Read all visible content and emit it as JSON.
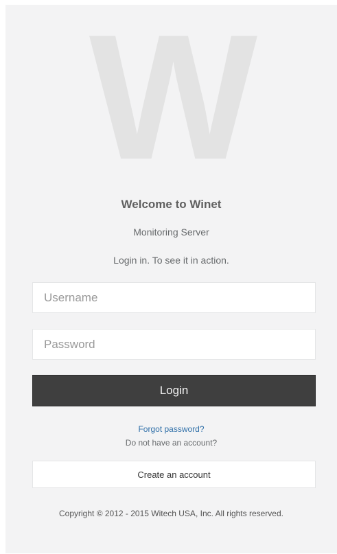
{
  "logo": {
    "letter": "W"
  },
  "header": {
    "title": "Welcome to Winet",
    "subtitle": "Monitoring Server",
    "tagline": "Login in. To see it in action."
  },
  "form": {
    "username_placeholder": "Username",
    "password_placeholder": "Password",
    "login_label": "Login",
    "forgot_label": "Forgot password?",
    "no_account_text": "Do not have an account?",
    "create_account_label": "Create an account"
  },
  "footer": {
    "copyright": "Copyright © 2012 - 2015 Witech USA, Inc. All rights reserved."
  },
  "colors": {
    "panel_bg": "#f3f3f4",
    "button_bg": "#3f3f3f",
    "link": "#2f6fa8"
  }
}
